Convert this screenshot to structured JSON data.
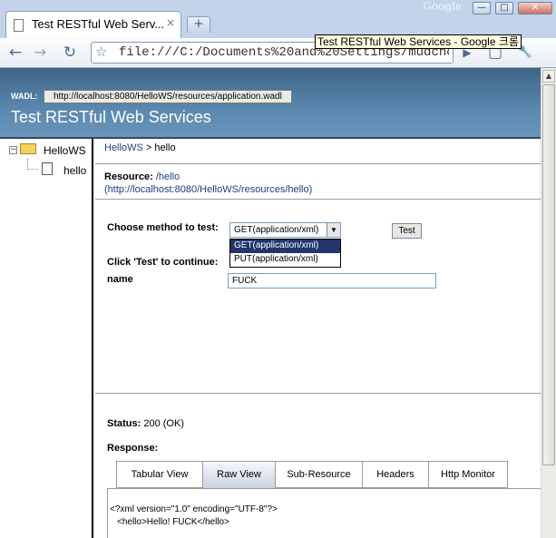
{
  "window": {
    "brand": "Google",
    "minimize": "—",
    "maximize": "□",
    "close": "✕"
  },
  "tab": {
    "title": "Test RESTful Web Serv...",
    "close": "×",
    "new_tab": "+"
  },
  "toolbar": {
    "back": "←",
    "forward": "→",
    "reload": "↻",
    "star": "☆",
    "url": "file:///C:/Documents%20and%20Settings/mudchobo/M",
    "go": "▶",
    "page_menu": "▢",
    "tools_menu": "🔧",
    "tooltip": "Test RESTful Web Services - Google 크롬"
  },
  "header": {
    "wadl_label": "WADL:",
    "wadl_url": "http://localhost:8080/HelloWS/resources/application.wadl",
    "title": "Test RESTful Web Services"
  },
  "tree": {
    "expander": "−",
    "root": "HelloWS",
    "child": "hello"
  },
  "content": {
    "crumb_link": "HelloWS",
    "crumb_sep": " > hello",
    "resource_label": "Resource: ",
    "resource_path": "/hello",
    "resource_url": "(http://localhost:8080/HelloWS/resources/hello)",
    "method_label": "Choose method to test:",
    "method_selected": "GET(application/xml)",
    "method_options": [
      "GET(application/xml)",
      "PUT(application/xml)"
    ],
    "test_button": "Test",
    "continue_label": "Click 'Test' to continue:",
    "name_label": "name",
    "name_value": "FUCK",
    "status_label": "Status: ",
    "status_value": "200 (OK)",
    "response_label": "Response:",
    "tabs": [
      "Tabular View",
      "Raw View",
      "Sub-Resource",
      "Headers",
      "Http Monitor"
    ],
    "raw_line1": "<?xml version=\"1.0\" encoding=\"UTF-8\"?>",
    "raw_line2": "<hello>Hello! FUCK</hello>"
  }
}
